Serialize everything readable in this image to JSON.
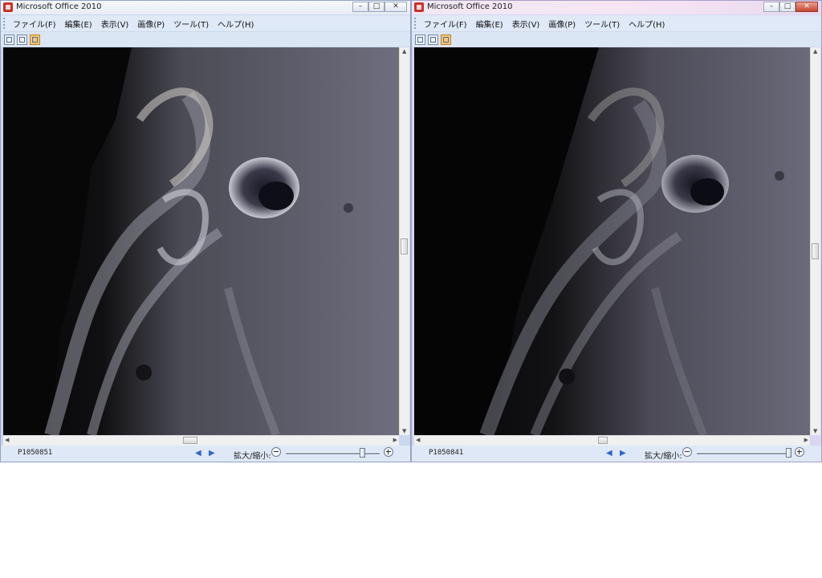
{
  "windows": [
    {
      "title": "Microsoft Office 2010",
      "caption_buttons": [
        "–",
        "□",
        "✕"
      ],
      "menu": [
        "ファイル(F)",
        "編集(E)",
        "表示(V)",
        "画像(P)",
        "ツール(T)",
        "ヘルプ(H)"
      ],
      "toolbar_icons": [
        "fit-view-icon",
        "actual-size-icon",
        "thumbnail-view-icon"
      ],
      "image_description_hidden": false,
      "status": {
        "file_name": "P1050851",
        "prev_icon": "◀",
        "next_icon": "▶",
        "zoom_label": "拡大/縮小:",
        "zoom_level": 0.82
      },
      "scroll": {
        "vertical": 0.5,
        "horizontal": 0.47
      }
    },
    {
      "title": "Microsoft Office 2010",
      "caption_buttons": [
        "–",
        "□",
        "✕"
      ],
      "menu": [
        "ファイル(F)",
        "編集(E)",
        "表示(V)",
        "画像(P)",
        "ツール(T)",
        "ヘルプ(H)"
      ],
      "toolbar_icons": [
        "fit-view-icon",
        "actual-size-icon",
        "thumbnail-view-icon"
      ],
      "status": {
        "file_name": "P1050841",
        "prev_icon": "◀",
        "next_icon": "▶",
        "zoom_label": "拡大/縮小:",
        "zoom_level": 0.98
      },
      "scroll": {
        "vertical": 0.52,
        "horizontal": 0.48
      }
    }
  ],
  "colors": {
    "title_left_bg": "#e8ecf4",
    "title_right_bg": "#f3e6f4",
    "menubar_bg": "#dfe9f7",
    "moon_gray": "#6c6c7d",
    "moon_shadow": "#0b0b0c"
  }
}
